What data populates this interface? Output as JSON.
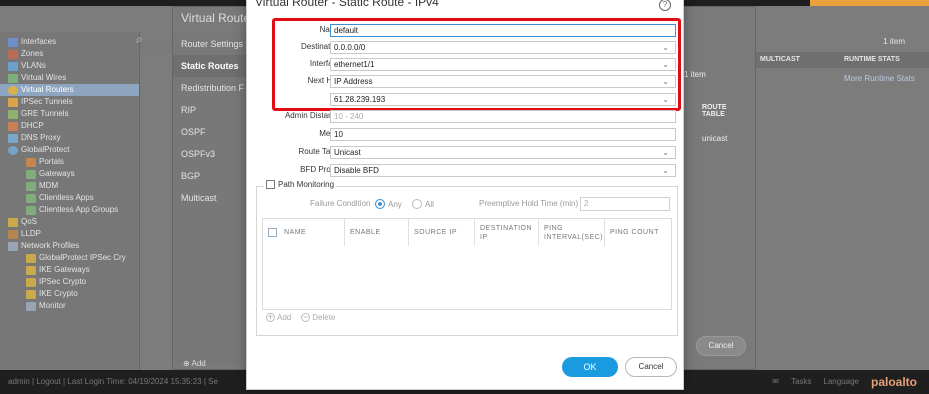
{
  "background": {
    "left_tree": [
      {
        "label": "Interfaces"
      },
      {
        "label": "Zones"
      },
      {
        "label": "VLANs"
      },
      {
        "label": "Virtual Wires"
      },
      {
        "label": "Virtual Routers"
      },
      {
        "label": "IPSec Tunnels"
      },
      {
        "label": "GRE Tunnels"
      },
      {
        "label": "DHCP"
      },
      {
        "label": "DNS Proxy"
      },
      {
        "label": "GlobalProtect"
      },
      {
        "label": "Portals"
      },
      {
        "label": "Gateways"
      },
      {
        "label": "MDM"
      },
      {
        "label": "Clientless Apps"
      },
      {
        "label": "Clientless App Groups"
      },
      {
        "label": "QoS"
      },
      {
        "label": "LLDP"
      },
      {
        "label": "Network Profiles"
      },
      {
        "label": "GlobalProtect IPSec Cry"
      },
      {
        "label": "IKE Gateways"
      },
      {
        "label": "IPSec Crypto"
      },
      {
        "label": "IKE Crypto"
      },
      {
        "label": "Monitor"
      }
    ],
    "vr_dialog_title": "Virtual Route",
    "vr_nav": [
      "Router Settings",
      "Static Routes",
      "Redistribution F",
      "RIP",
      "OSPF",
      "OSPFv3",
      "BGP",
      "Multicast"
    ],
    "right_panel": {
      "count": "1 item",
      "col_multicast": "MULTICAST",
      "col_runtime": "RUNTIME STATS",
      "runtime_link": "More Runtime Stats",
      "inner_count": "1 item",
      "col_route_table": "ROUTE TABLE",
      "route_table_value": "unicast",
      "cancel": "Cancel"
    },
    "add_label": "Add",
    "status_left": "admin | Logout | Last Login Time: 04/19/2024 15:35:23 | Se",
    "status_tasks": "Tasks",
    "status_language": "Language",
    "logo": "paloalto"
  },
  "dialog": {
    "title": "Virtual Router - Static Route - IPv4",
    "fields": {
      "name_label": "Name",
      "name_value": "default",
      "destination_label": "Destination",
      "destination_value": "0.0.0.0/0",
      "interface_label": "Interface",
      "interface_value": "ethernet1/1",
      "nexthop_label": "Next Hop",
      "nexthop_value": "IP Address",
      "nexthop_ip": "61.28.239.193",
      "admin_distance_label": "Admin Distance",
      "admin_distance_placeholder": "10 - 240",
      "metric_label": "Metric",
      "metric_value": "10",
      "route_table_label": "Route Table",
      "route_table_value": "Unicast",
      "bfd_label": "BFD Profile",
      "bfd_value": "Disable BFD"
    },
    "path_monitoring": {
      "label": "Path Monitoring",
      "failure_condition_label": "Failure Condition",
      "option_any": "Any",
      "option_all": "All",
      "preemptive_label": "Preemptive Hold Time (min)",
      "preemptive_value": "2",
      "columns": [
        "NAME",
        "ENABLE",
        "SOURCE IP",
        "DESTINATION IP",
        "PING INTERVAL(SEC)",
        "PING COUNT"
      ],
      "add_label": "Add",
      "delete_label": "Delete"
    },
    "ok_label": "OK",
    "cancel_label": "Cancel"
  },
  "colors": {
    "highlight_box": "#e30b14",
    "primary_button": "#1a9be0"
  }
}
